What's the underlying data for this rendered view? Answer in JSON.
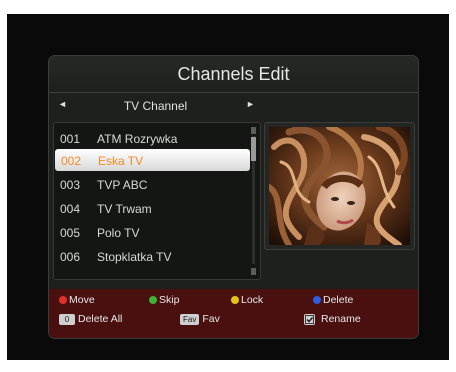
{
  "header": {
    "title": "Channels Edit"
  },
  "group": {
    "label": "TV Channel",
    "left_icon": "left-arrow-icon",
    "right_icon": "right-arrow-icon"
  },
  "channels": [
    {
      "number": "001",
      "name": "ATM Rozrywka"
    },
    {
      "number": "002",
      "name": "Eska TV"
    },
    {
      "number": "003",
      "name": "TVP ABC"
    },
    {
      "number": "004",
      "name": "TV Trwam"
    },
    {
      "number": "005",
      "name": "Polo TV"
    },
    {
      "number": "006",
      "name": "Stopklatka TV"
    }
  ],
  "selected_index": 1,
  "help": {
    "move": {
      "label": "Move",
      "color": "#e0302a"
    },
    "skip": {
      "label": "Skip",
      "color": "#3fb23a"
    },
    "lock": {
      "label": "Lock",
      "color": "#e6c21a"
    },
    "delete": {
      "label": "Delete",
      "color": "#2f5de0"
    },
    "delete_all": {
      "key": "0",
      "label": "Delete All"
    },
    "fav": {
      "key": "Fav",
      "label": "Fav"
    },
    "rename": {
      "icon": "check-icon",
      "label": "Rename"
    }
  },
  "colors": {
    "panel": "#1e201e",
    "help_bar": "#4a1010",
    "selected_text": "#f08c2a"
  }
}
